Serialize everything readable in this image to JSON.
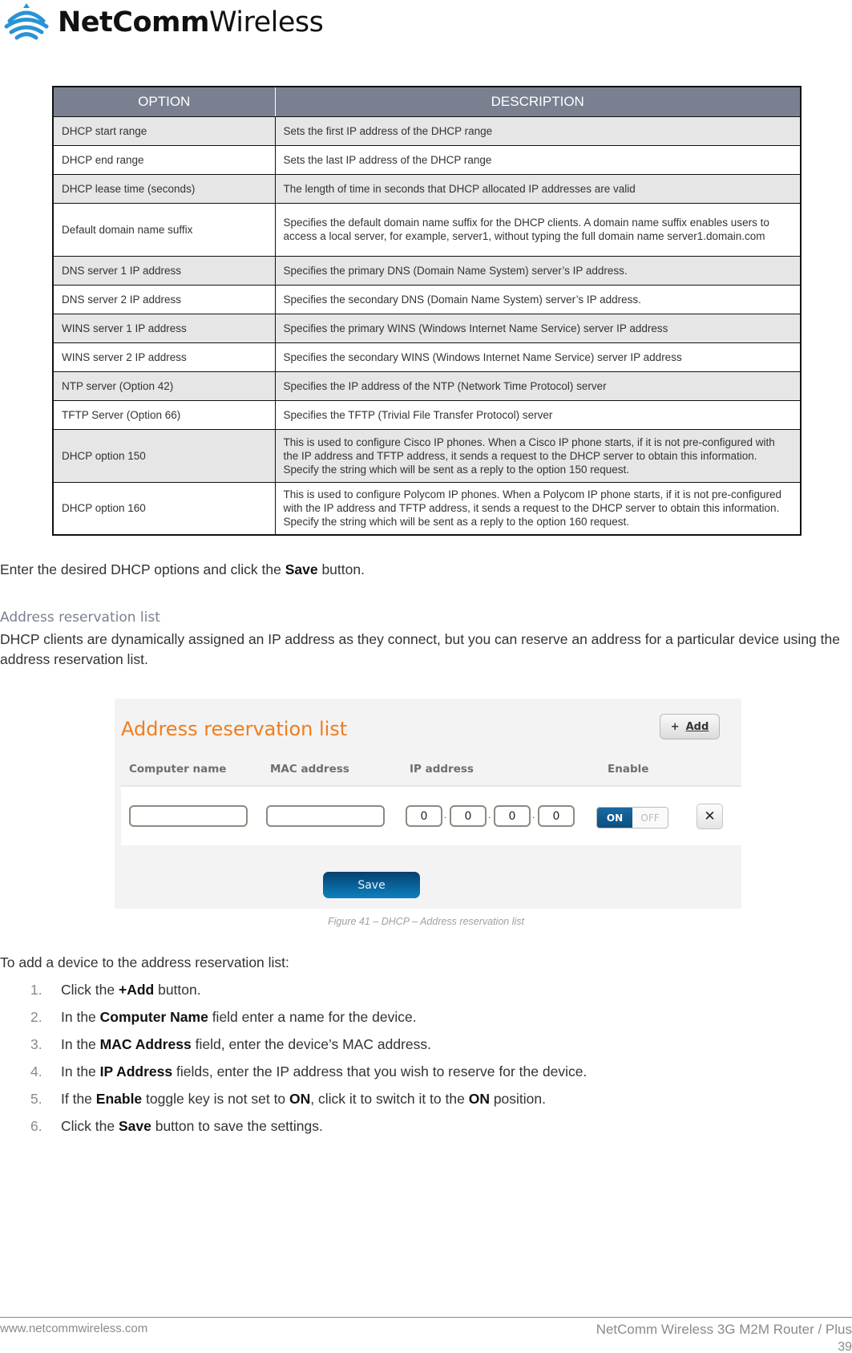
{
  "header": {
    "logo_bold": "NetComm",
    "logo_light": "Wireless",
    "logo_icon": "wifi-signal-icon"
  },
  "options_table": {
    "columns": [
      "OPTION",
      "DESCRIPTION"
    ],
    "rows": [
      {
        "option": "DHCP start range",
        "description": "Sets the first IP address of the DHCP range"
      },
      {
        "option": "DHCP end range",
        "description": "Sets the last IP address of the DHCP range"
      },
      {
        "option": "DHCP lease time (seconds)",
        "description": "The length of time in seconds that DHCP allocated IP addresses are valid"
      },
      {
        "option": "Default domain name suffix",
        "description": "Specifies the default domain name suffix for the DHCP clients. A domain name suffix enables users to access a local server, for example, server1, without typing the full domain name server1.domain.com"
      },
      {
        "option": "DNS server 1 IP address",
        "description": "Specifies the primary DNS (Domain Name System) server’s IP address."
      },
      {
        "option": "DNS server 2 IP address",
        "description": "Specifies the secondary DNS (Domain Name System) server’s IP address."
      },
      {
        "option": "WINS server 1 IP address",
        "description": "Specifies the primary WINS (Windows Internet Name Service) server IP address"
      },
      {
        "option": "WINS server 2 IP address",
        "description": "Specifies the secondary WINS (Windows Internet Name Service) server IP address"
      },
      {
        "option": "NTP server (Option 42)",
        "description": "Specifies the IP address of the NTP (Network Time Protocol) server"
      },
      {
        "option": "TFTP Server (Option 66)",
        "description": "Specifies the TFTP (Trivial File Transfer Protocol) server"
      },
      {
        "option": "DHCP option 150",
        "description": "This is used to configure Cisco IP phones. When a Cisco IP phone starts, if it is not pre-configured with the IP address and TFTP address, it sends a request to the DHCP server to obtain this information. Specify the string which will be sent as a reply to the option 150 request."
      },
      {
        "option": "DHCP option 160",
        "description": "This is used to configure Polycom IP phones. When a Polycom IP phone starts, if it is not pre-configured with the IP address and TFTP address, it sends a request to the DHCP server to obtain this information. Specify the string which will be sent as a reply to the option 160 request."
      }
    ]
  },
  "save_instruction": {
    "before": "Enter the desired DHCP options and click the ",
    "bold": "Save",
    "after": " button."
  },
  "section": {
    "heading": "Address reservation list",
    "intro": "DHCP clients are dynamically assigned an IP address as they connect, but you can reserve an address for a particular device using the address reservation list."
  },
  "figure": {
    "title": "Address reservation list",
    "add_button": {
      "icon": "plus-icon",
      "icon_glyph": "+",
      "label": "Add"
    },
    "columns": [
      "Computer name",
      "MAC address",
      "IP address",
      "Enable"
    ],
    "row": {
      "computer_name": "",
      "mac_address": "",
      "ip_octets": [
        "0",
        "0",
        "0",
        "0"
      ],
      "ip_separator": ".",
      "enable": {
        "on_label": "ON",
        "off_label": "OFF",
        "state": "ON"
      },
      "delete_glyph": "✕"
    },
    "save_label": "Save",
    "caption": "Figure 41 – DHCP – Address reservation list",
    "colors": {
      "title": "#f07d1b",
      "save_button": "#0b5f98",
      "toggle_on": "#105e94"
    }
  },
  "steps": {
    "intro": "To add a device to the address reservation list:",
    "items": [
      {
        "num": "1.",
        "pre": "Click the ",
        "b1": "+Add",
        "mid": " button.",
        "b2": "",
        "post": ""
      },
      {
        "num": "2.",
        "pre": "In the ",
        "b1": "Computer Name",
        "mid": " field enter a name for the device.",
        "b2": "",
        "post": ""
      },
      {
        "num": "3.",
        "pre": "In the ",
        "b1": "MAC Address",
        "mid": " field, enter the device’s MAC address.",
        "b2": "",
        "post": ""
      },
      {
        "num": "4.",
        "pre": "In the ",
        "b1": "IP Address",
        "mid": " fields, enter the IP address that you wish to reserve for the device.",
        "b2": "",
        "post": ""
      },
      {
        "num": "5.",
        "pre": "If the ",
        "b1": "Enable",
        "mid": " toggle key is not set to ",
        "b2": "ON",
        "mid2": ", click it to switch it to the ",
        "b3": "ON",
        "post": " position."
      },
      {
        "num": "6.",
        "pre": "Click the ",
        "b1": "Save",
        "mid": " button to save the settings.",
        "b2": "",
        "post": ""
      }
    ]
  },
  "footer": {
    "website": "www.netcommwireless.com",
    "product": "NetComm Wireless 3G M2M Router / Plus",
    "page": "39"
  }
}
